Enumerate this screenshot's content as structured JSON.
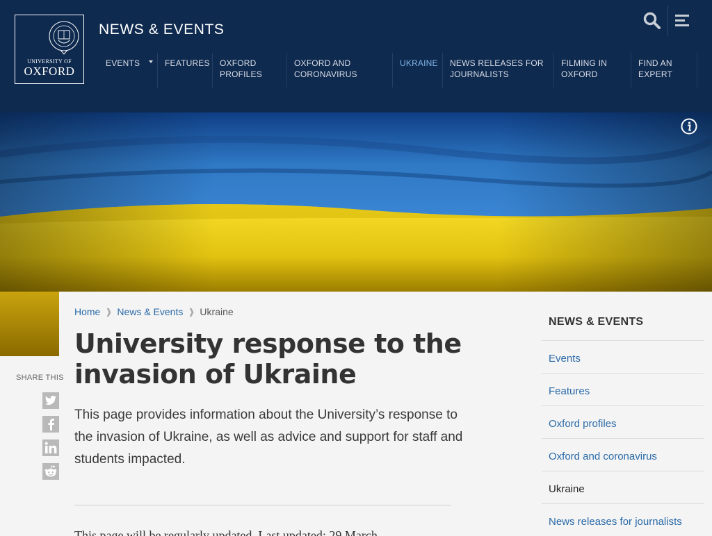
{
  "header": {
    "logo_university": "UNIVERSITY OF",
    "logo_oxford": "OXFORD",
    "site_title": "NEWS & EVENTS"
  },
  "nav": [
    {
      "label": "EVENTS",
      "has_dropdown": true
    },
    {
      "label": "FEATURES"
    },
    {
      "label": "OXFORD PROFILES"
    },
    {
      "label": "OXFORD AND CORONAVIRUS"
    },
    {
      "label": "UKRAINE",
      "active": true
    },
    {
      "label": "NEWS RELEASES FOR JOURNALISTS"
    },
    {
      "label": "FILMING IN OXFORD"
    },
    {
      "label": "FIND AN EXPERT"
    }
  ],
  "breadcrumb": {
    "home": "Home",
    "section": "News & Events",
    "current": "Ukraine"
  },
  "page": {
    "title": "University response to the invasion of Ukraine",
    "lead": "This page provides information about the University’s response to the invasion of Ukraine, as well as advice and support for staff and students impacted.",
    "body_start": "This page will be regularly updated. Last updated: 29 March"
  },
  "share": {
    "label": "SHARE THIS",
    "buttons": [
      "twitter",
      "facebook",
      "linkedin",
      "reddit"
    ]
  },
  "sidebar": {
    "heading": "NEWS & EVENTS",
    "items": [
      {
        "label": "Events"
      },
      {
        "label": "Features"
      },
      {
        "label": "Oxford profiles"
      },
      {
        "label": "Oxford and coronavirus"
      },
      {
        "label": "Ukraine",
        "current": true
      },
      {
        "label": "News releases for journalists"
      }
    ]
  },
  "colors": {
    "header_bg": "#0f2a4f",
    "link": "#2b6aa8",
    "nav_active": "#7fb4e6",
    "flag_blue": "#2f78c4",
    "flag_yellow": "#f2d21a"
  }
}
